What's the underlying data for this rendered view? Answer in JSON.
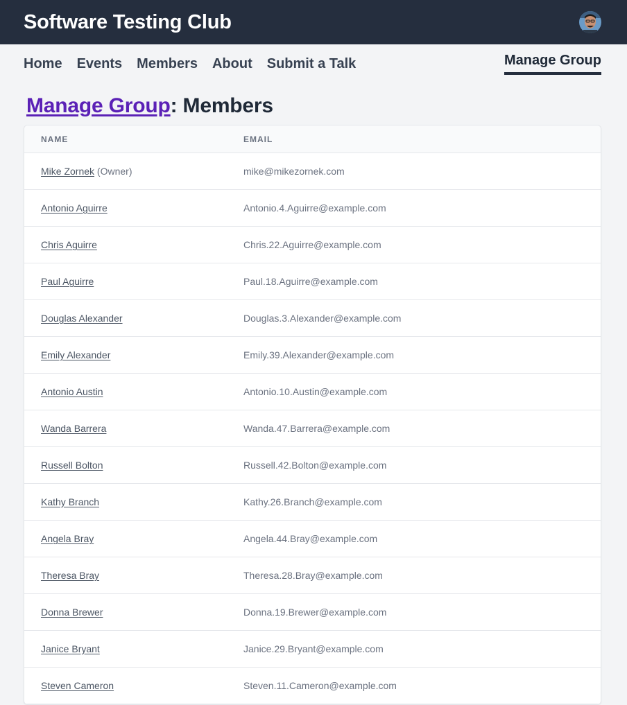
{
  "header": {
    "title": "Software Testing Club",
    "avatar_icon": "user-avatar"
  },
  "nav": {
    "links": [
      "Home",
      "Events",
      "Members",
      "About",
      "Submit a Talk"
    ],
    "active": "Manage Group"
  },
  "page": {
    "heading_link": "Manage Group",
    "heading_rest": ": Members"
  },
  "table": {
    "columns": [
      "NAME",
      "EMAIL"
    ],
    "rows": [
      {
        "name": "Mike Zornek",
        "suffix": " (Owner)",
        "email": "mike@mikezornek.com"
      },
      {
        "name": "Antonio Aguirre",
        "suffix": "",
        "email": "Antonio.4.Aguirre@example.com"
      },
      {
        "name": "Chris Aguirre",
        "suffix": "",
        "email": "Chris.22.Aguirre@example.com"
      },
      {
        "name": "Paul Aguirre",
        "suffix": "",
        "email": "Paul.18.Aguirre@example.com"
      },
      {
        "name": "Douglas Alexander",
        "suffix": "",
        "email": "Douglas.3.Alexander@example.com"
      },
      {
        "name": "Emily Alexander",
        "suffix": "",
        "email": "Emily.39.Alexander@example.com"
      },
      {
        "name": "Antonio Austin",
        "suffix": "",
        "email": "Antonio.10.Austin@example.com"
      },
      {
        "name": "Wanda Barrera",
        "suffix": "",
        "email": "Wanda.47.Barrera@example.com"
      },
      {
        "name": "Russell Bolton",
        "suffix": "",
        "email": "Russell.42.Bolton@example.com"
      },
      {
        "name": "Kathy Branch",
        "suffix": "",
        "email": "Kathy.26.Branch@example.com"
      },
      {
        "name": "Angela Bray",
        "suffix": "",
        "email": "Angela.44.Bray@example.com"
      },
      {
        "name": "Theresa Bray",
        "suffix": "",
        "email": "Theresa.28.Bray@example.com"
      },
      {
        "name": "Donna Brewer",
        "suffix": "",
        "email": "Donna.19.Brewer@example.com"
      },
      {
        "name": "Janice Bryant",
        "suffix": "",
        "email": "Janice.29.Bryant@example.com"
      },
      {
        "name": "Steven Cameron",
        "suffix": "",
        "email": "Steven.11.Cameron@example.com"
      }
    ]
  },
  "colors": {
    "header_bg": "#252e3e",
    "link_accent": "#5b21b6",
    "page_bg": "#f3f4f6"
  }
}
